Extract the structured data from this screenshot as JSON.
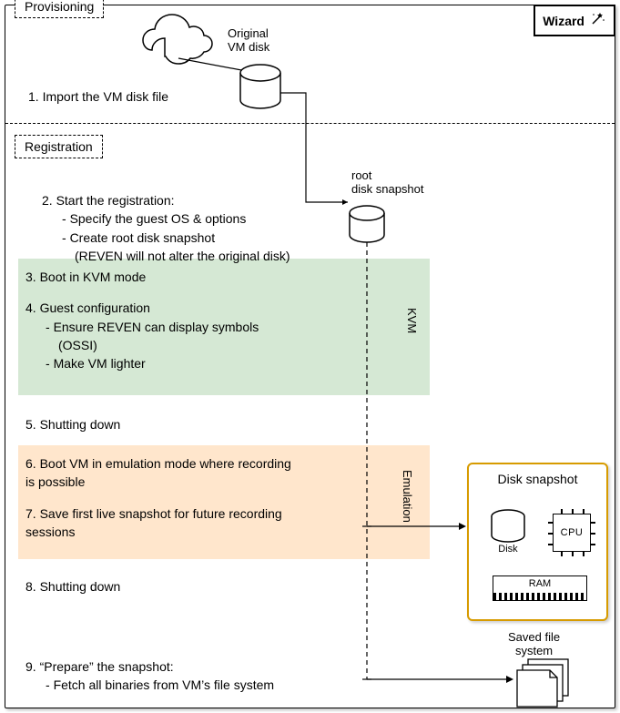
{
  "wizard_label": "Wizard",
  "sections": {
    "provisioning": "Provisioning",
    "registration": "Registration"
  },
  "labels": {
    "original_disk": "Original\nVM disk",
    "root_snapshot": "root\ndisk snapshot",
    "kvm": "KVM",
    "emulation": "Emulation",
    "disk_snapshot_title": "Disk snapshot",
    "disk": "Disk",
    "cpu": "CPU",
    "ram": "RAM",
    "saved_fs": "Saved file\nsystem"
  },
  "steps": {
    "s1": "1.  Import the VM disk file",
    "s2": "2.  Start the registration:",
    "s2a": "Specify the guest OS & options",
    "s2b": "Create root disk snapshot",
    "s2b_note": "(REVEN will not alter the original disk)",
    "s3": "3. Boot in KVM mode",
    "s4": "4. Guest configuration",
    "s4a": "Ensure REVEN can display symbols (OSSI)",
    "s4b": "Make VM lighter",
    "s5": "5. Shutting down",
    "s6": "6. Boot VM in emulation mode where recording is possible",
    "s7": "7. Save first live snapshot for future recording sessions",
    "s8": "8. Shutting down",
    "s9": "9. “Prepare” the snapshot:",
    "s9a": "Fetch all binaries from VM’s file system"
  }
}
